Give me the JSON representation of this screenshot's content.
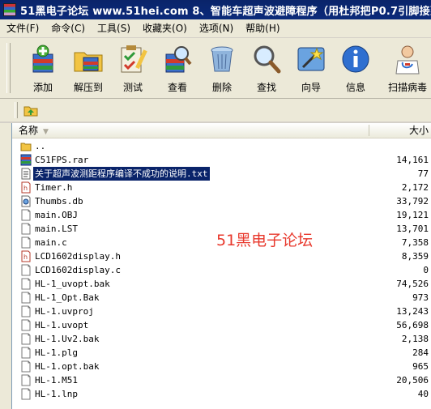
{
  "window": {
    "title": "51黑电子论坛 www.51hei.com 8、智能车超声波避障程序（用杜邦把P0.7引脚接到 C"
  },
  "menubar": {
    "items": [
      "文件(F)",
      "命令(C)",
      "工具(S)",
      "收藏夹(O)",
      "选项(N)",
      "帮助(H)"
    ]
  },
  "toolbar": {
    "add": "添加",
    "extract": "解压到",
    "test": "测试",
    "view": "查看",
    "delete": "删除",
    "find": "查找",
    "wizard": "向导",
    "info": "信息",
    "scan": "扫描病毒"
  },
  "list": {
    "col_name": "名称",
    "col_size": "大小",
    "files": [
      {
        "name": "..",
        "size": "",
        "icon": "folder-up-icon"
      },
      {
        "name": "C51FPS.rar",
        "size": "14,161",
        "icon": "rar-archive-icon"
      },
      {
        "name": "关于超声波测距程序编译不成功的说明.txt",
        "size": "77",
        "icon": "text-file-icon",
        "selected": true
      },
      {
        "name": "Timer.h",
        "size": "2,172",
        "icon": "header-file-icon"
      },
      {
        "name": "Thumbs.db",
        "size": "33,792",
        "icon": "thumbs-db-icon"
      },
      {
        "name": "main.OBJ",
        "size": "19,121",
        "icon": "file-icon"
      },
      {
        "name": "main.LST",
        "size": "13,701",
        "icon": "file-icon"
      },
      {
        "name": "main.c",
        "size": "7,358",
        "icon": "file-icon"
      },
      {
        "name": "LCD1602display.h",
        "size": "8,359",
        "icon": "header-file-icon"
      },
      {
        "name": "LCD1602display.c",
        "size": "0",
        "icon": "file-icon"
      },
      {
        "name": "HL-1_uvopt.bak",
        "size": "74,526",
        "icon": "file-icon"
      },
      {
        "name": "HL-1_Opt.Bak",
        "size": "973",
        "icon": "file-icon"
      },
      {
        "name": "HL-1.uvproj",
        "size": "13,243",
        "icon": "file-icon"
      },
      {
        "name": "HL-1.uvopt",
        "size": "56,698",
        "icon": "file-icon"
      },
      {
        "name": "HL-1.Uv2.bak",
        "size": "2,138",
        "icon": "file-icon"
      },
      {
        "name": "HL-1.plg",
        "size": "284",
        "icon": "file-icon"
      },
      {
        "name": "HL-1.opt.bak",
        "size": "965",
        "icon": "file-icon"
      },
      {
        "name": "HL-1.M51",
        "size": "20,506",
        "icon": "file-icon"
      },
      {
        "name": "HL-1.lnp",
        "size": "40",
        "icon": "file-icon"
      }
    ]
  },
  "watermark": "51黑电子论坛"
}
